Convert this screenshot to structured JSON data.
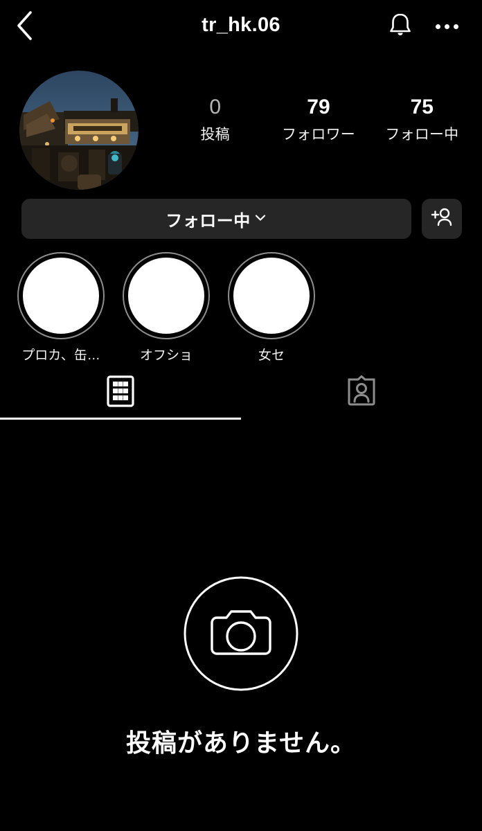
{
  "header": {
    "back_icon": "chevron-left-icon",
    "title": "tr_hk.06",
    "bell_icon": "bell-icon",
    "menu_icon": "more-options-icon"
  },
  "profile": {
    "avatar_alt": "night-scene-themed-building-photo",
    "stats": [
      {
        "value": "0",
        "label": "投稿",
        "dim": true
      },
      {
        "value": "79",
        "label": "フォロワー",
        "dim": false
      },
      {
        "value": "75",
        "label": "フォロー中",
        "dim": false
      }
    ]
  },
  "actions": {
    "follow_label": "フォロー中",
    "follow_chevron_icon": "chevron-down-icon",
    "add_user_icon": "add-person-icon"
  },
  "highlights": [
    {
      "label": "プロカ、缶…"
    },
    {
      "label": "オフショ"
    },
    {
      "label": "女セ"
    }
  ],
  "tabs": [
    {
      "name": "grid",
      "icon": "grid-icon",
      "active": true
    },
    {
      "name": "tagged",
      "icon": "tagged-person-icon",
      "active": false
    }
  ],
  "empty_state": {
    "icon": "camera-icon",
    "message": "投稿がありません。"
  },
  "colors": {
    "background": "#000000",
    "button_bg": "#262626",
    "text": "#ffffff",
    "muted": "#8e8e8e"
  }
}
